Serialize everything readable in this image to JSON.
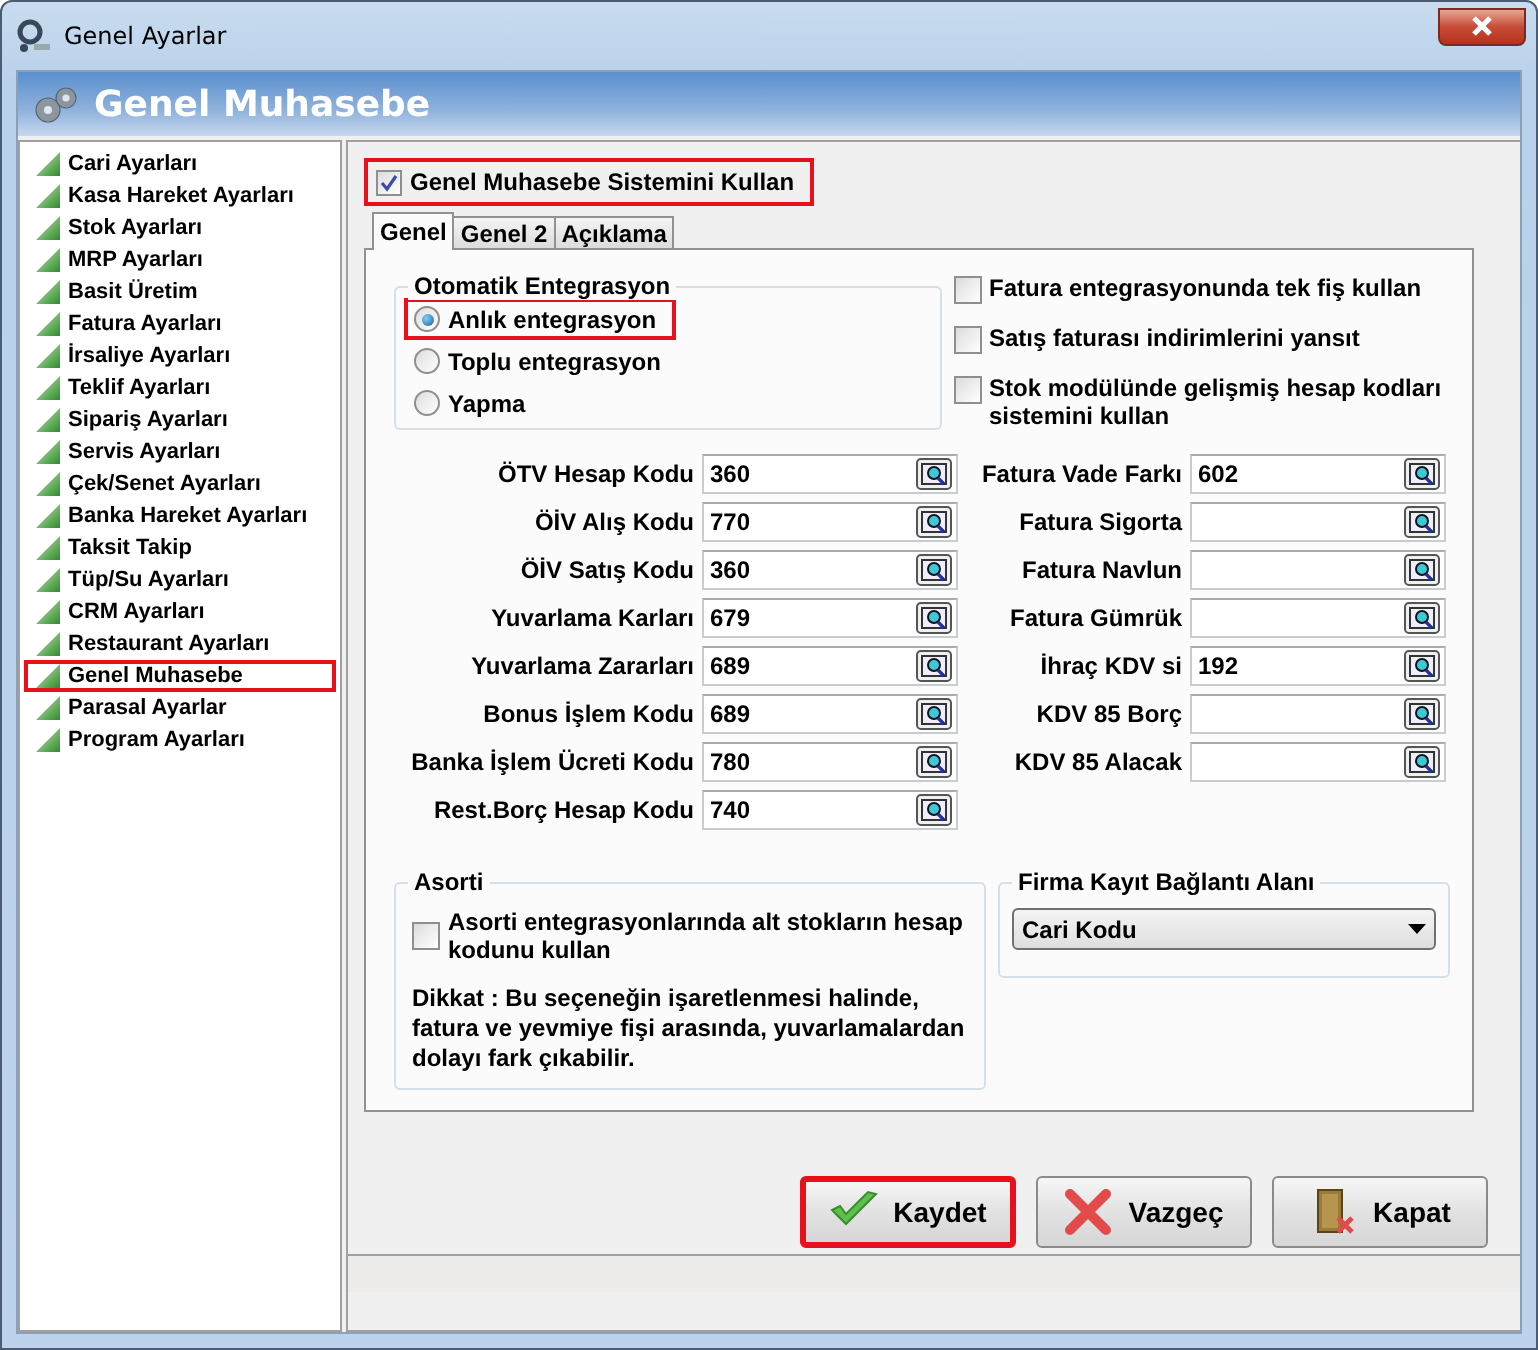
{
  "window": {
    "title": "Genel Ayarlar"
  },
  "header": {
    "title": "Genel Muhasebe"
  },
  "sidebar": {
    "items": [
      {
        "label": "Cari Ayarları",
        "highlighted": false
      },
      {
        "label": "Kasa Hareket Ayarları",
        "highlighted": false
      },
      {
        "label": "Stok Ayarları",
        "highlighted": false
      },
      {
        "label": "MRP Ayarları",
        "highlighted": false
      },
      {
        "label": "Basit Üretim",
        "highlighted": false
      },
      {
        "label": "Fatura Ayarları",
        "highlighted": false
      },
      {
        "label": "İrsaliye Ayarları",
        "highlighted": false
      },
      {
        "label": "Teklif Ayarları",
        "highlighted": false
      },
      {
        "label": "Sipariş Ayarları",
        "highlighted": false
      },
      {
        "label": "Servis Ayarları",
        "highlighted": false
      },
      {
        "label": "Çek/Senet Ayarları",
        "highlighted": false
      },
      {
        "label": "Banka Hareket Ayarları",
        "highlighted": false
      },
      {
        "label": "Taksit Takip",
        "highlighted": false
      },
      {
        "label": "Tüp/Su Ayarları",
        "highlighted": false
      },
      {
        "label": "CRM Ayarları",
        "highlighted": false
      },
      {
        "label": "Restaurant Ayarları",
        "highlighted": false
      },
      {
        "label": "Genel Muhasebe",
        "highlighted": true
      },
      {
        "label": "Parasal Ayarlar",
        "highlighted": false
      },
      {
        "label": "Program Ayarları",
        "highlighted": false
      }
    ]
  },
  "use_system": {
    "label": "Genel Muhasebe Sistemini Kullan",
    "checked": true,
    "highlighted": true
  },
  "tabs": [
    {
      "label": "Genel",
      "selected": true
    },
    {
      "label": "Genel 2",
      "selected": false
    },
    {
      "label": "Açıklama",
      "selected": false
    }
  ],
  "integration": {
    "title": "Otomatik Entegrasyon",
    "options": [
      {
        "label": "Anlık entegrasyon",
        "selected": true,
        "highlighted": true
      },
      {
        "label": "Toplu entegrasyon",
        "selected": false,
        "highlighted": false
      },
      {
        "label": "Yapma",
        "selected": false,
        "highlighted": false
      }
    ]
  },
  "options": [
    {
      "label": "Fatura entegrasyonunda tek fiş kullan",
      "checked": false
    },
    {
      "label": "Satış faturası indirimlerini yansıt",
      "checked": false
    },
    {
      "label": "Stok modülünde gelişmiş hesap kodları sistemini kullan",
      "checked": false
    }
  ],
  "left_fields": [
    {
      "label": "ÖTV Hesap Kodu",
      "value": "360"
    },
    {
      "label": "ÖİV Alış Kodu",
      "value": "770"
    },
    {
      "label": "ÖİV Satış Kodu",
      "value": "360"
    },
    {
      "label": "Yuvarlama Karları",
      "value": "679"
    },
    {
      "label": "Yuvarlama Zararları",
      "value": "689"
    },
    {
      "label": "Bonus İşlem Kodu",
      "value": "689"
    },
    {
      "label": "Banka İşlem Ücreti Kodu",
      "value": "780"
    },
    {
      "label": "Rest.Borç Hesap Kodu",
      "value": "740"
    }
  ],
  "right_fields": [
    {
      "label": "Fatura Vade Farkı",
      "value": "602"
    },
    {
      "label": "Fatura Sigorta"
    },
    {
      "label": "Fatura Navlun"
    },
    {
      "label": "Fatura Gümrük"
    },
    {
      "label": "İhraç KDV si",
      "value": "192"
    },
    {
      "label": "KDV 85 Borç"
    },
    {
      "label": "KDV 85 Alacak"
    }
  ],
  "asorti": {
    "title": "Asorti",
    "checkbox": {
      "label": "Asorti entegrasyonlarında alt stokların hesap kodunu kullan",
      "checked": false
    },
    "note": "Dikkat : Bu seçeneğin işaretlenmesi halinde, fatura ve yevmiye fişi arasında, yuvarlamalardan dolayı fark çıkabilir."
  },
  "firma": {
    "title": "Firma Kayıt Bağlantı Alanı",
    "dropdown": {
      "value": "Cari Kodu"
    }
  },
  "buttons": [
    {
      "label": "Kaydet",
      "kind": "save",
      "highlighted": true
    },
    {
      "label": "Vazgeç",
      "kind": "cancel",
      "highlighted": false
    },
    {
      "label": "Kapat",
      "kind": "close",
      "highlighted": false
    }
  ]
}
